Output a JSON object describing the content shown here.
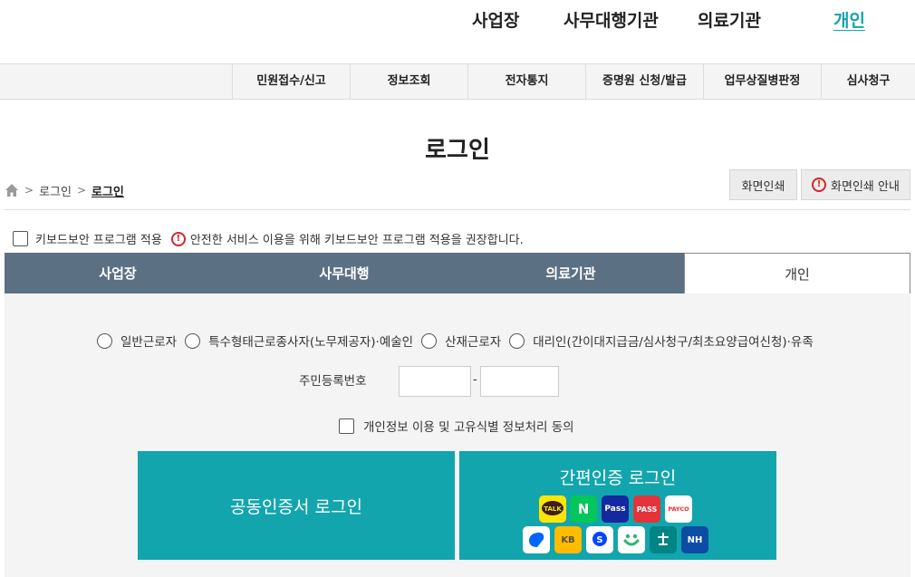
{
  "topnav": [
    "사업장",
    "사무대행기관",
    "의료기관",
    "개인"
  ],
  "menu": [
    "민원접수/신고",
    "정보조회",
    "전자통지",
    "증명원 신청/발급",
    "업무상질병판정",
    "심사청구"
  ],
  "page_title": "로그인",
  "breadcrumb": [
    "로그인",
    "로그인"
  ],
  "print_buttons": [
    "화면인쇄",
    "화면인쇄 안내"
  ],
  "keyboard_security": {
    "label": "키보드보안 프로그램 적용",
    "notice": "안전한 서비스 이용을 위해 키보드보안 프로그램 적용을 권장합니다."
  },
  "tabs": [
    "사업장",
    "사무대행",
    "의료기관",
    "개인"
  ],
  "radios": [
    "일반근로자",
    "특수형태근로종사자(노무제공자)·예술인",
    "산재근로자",
    "대리인(간이대지급금/심사청구/최초요양급여신청)·유족"
  ],
  "rrn": {
    "label": "주민등록번호",
    "separator": "-"
  },
  "consent_label": "개인정보 이용 및 고유식별 정보처리 동의",
  "cert_login_label": "공동인증서 로그인",
  "simple_login": {
    "title": "간편인증 로그인",
    "providers": [
      "TALK",
      "N",
      "Pass",
      "PASS",
      "PAYCO",
      "",
      "KB",
      "S",
      "",
      "",
      "NH"
    ]
  },
  "colors": {
    "accent": "#13a5ad",
    "tab_bg": "#5b7083",
    "warn": "#d6242b"
  }
}
